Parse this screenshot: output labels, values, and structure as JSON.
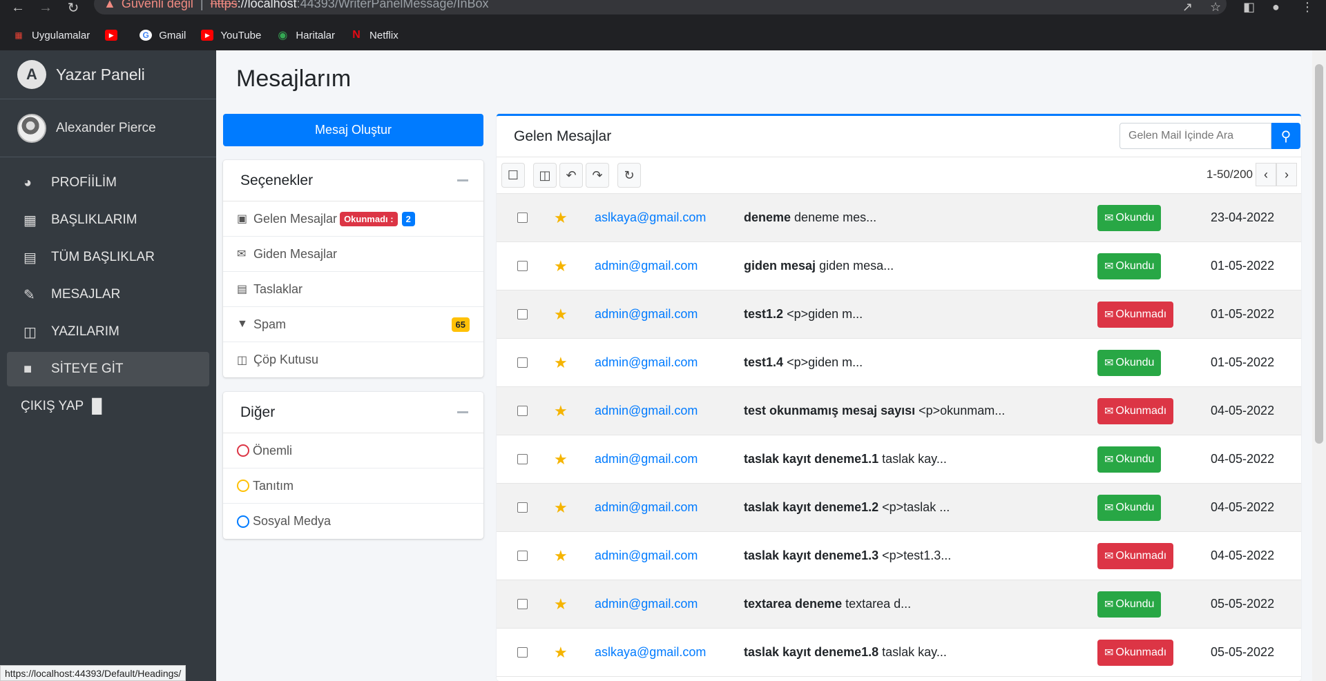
{
  "browser": {
    "security_text": "Güvenli değil",
    "url_scheme": "https",
    "url_host": "://localhost",
    "url_path": ":44393/WriterPanelMessage/InBox",
    "bookmarks": [
      {
        "label": "Uygulamalar",
        "icon": "apps-grid-icon"
      },
      {
        "label": "",
        "icon": "youtube-icon"
      },
      {
        "label": "Gmail",
        "icon": "google-icon"
      },
      {
        "label": "YouTube",
        "icon": "youtube-icon"
      },
      {
        "label": "Haritalar",
        "icon": "maps-icon"
      },
      {
        "label": "Netflix",
        "icon": "netflix-icon"
      }
    ],
    "status_url": "https://localhost:44393/Default/Headings/"
  },
  "sidebar": {
    "brand": "Yazar Paneli",
    "user": "Alexander Pierce",
    "items": [
      {
        "label": "PROFİİLİM",
        "icon": "dashboard-icon"
      },
      {
        "label": "BAŞLIKLARIM",
        "icon": "grid-icon"
      },
      {
        "label": "TÜM BAŞLIKLAR",
        "icon": "list-icon"
      },
      {
        "label": "MESAJLAR",
        "icon": "edit-icon"
      },
      {
        "label": "YAZILARIM",
        "icon": "table-icon"
      },
      {
        "label": "SİTEYE GİT",
        "icon": "book-icon"
      }
    ],
    "logout": "ÇIKIŞ YAP"
  },
  "page": {
    "title": "Mesajlarım",
    "compose_label": "Mesaj Oluştur"
  },
  "options": {
    "title": "Seçenekler",
    "inbox": "Gelen Mesajlar",
    "unread_badge": "Okunmadı :",
    "unread_count": "2",
    "sent": "Giden Mesajlar",
    "drafts": "Taslaklar",
    "spam": "Spam",
    "spam_count": "65",
    "trash": "Çöp Kutusu"
  },
  "other": {
    "title": "Diğer",
    "labels": [
      {
        "label": "Önemli",
        "color": "#dc3545"
      },
      {
        "label": "Tanıtım",
        "color": "#ffc107"
      },
      {
        "label": "Sosyal Medya",
        "color": "#007bff"
      }
    ]
  },
  "mailbox": {
    "title": "Gelen Mesajlar",
    "search_placeholder": "Gelen Mail İçinde Ara",
    "pagination": "1-50/200",
    "read_label": "Okundu",
    "unread_label": "Okunmadı",
    "messages": [
      {
        "from": "aslkaya@gmail.com",
        "subject": "deneme",
        "preview": "deneme mes...",
        "status": "read",
        "date": "23-04-2022"
      },
      {
        "from": "admin@gmail.com",
        "subject": "giden mesaj",
        "preview": "giden mesa...",
        "status": "read",
        "date": "01-05-2022"
      },
      {
        "from": "admin@gmail.com",
        "subject": "test1.2",
        "preview": "<p>giden m...",
        "status": "unread",
        "date": "01-05-2022"
      },
      {
        "from": "admin@gmail.com",
        "subject": "test1.4",
        "preview": "<p>giden m...",
        "status": "read",
        "date": "01-05-2022"
      },
      {
        "from": "admin@gmail.com",
        "subject": "test okunmamış mesaj sayısı",
        "preview": "<p>okunmam...",
        "status": "unread",
        "date": "04-05-2022"
      },
      {
        "from": "admin@gmail.com",
        "subject": "taslak kayıt deneme1.1",
        "preview": "taslak kay...",
        "status": "read",
        "date": "04-05-2022"
      },
      {
        "from": "admin@gmail.com",
        "subject": "taslak kayıt deneme1.2",
        "preview": "<p>taslak ...",
        "status": "read",
        "date": "04-05-2022"
      },
      {
        "from": "admin@gmail.com",
        "subject": "taslak kayıt deneme1.3",
        "preview": "<p>test1.3...",
        "status": "unread",
        "date": "04-05-2022"
      },
      {
        "from": "admin@gmail.com",
        "subject": "textarea deneme",
        "preview": "textarea d...",
        "status": "read",
        "date": "05-05-2022"
      },
      {
        "from": "aslkaya@gmail.com",
        "subject": "taslak kayıt deneme1.8",
        "preview": "taslak kay...",
        "status": "unread",
        "date": "05-05-2022"
      }
    ]
  }
}
